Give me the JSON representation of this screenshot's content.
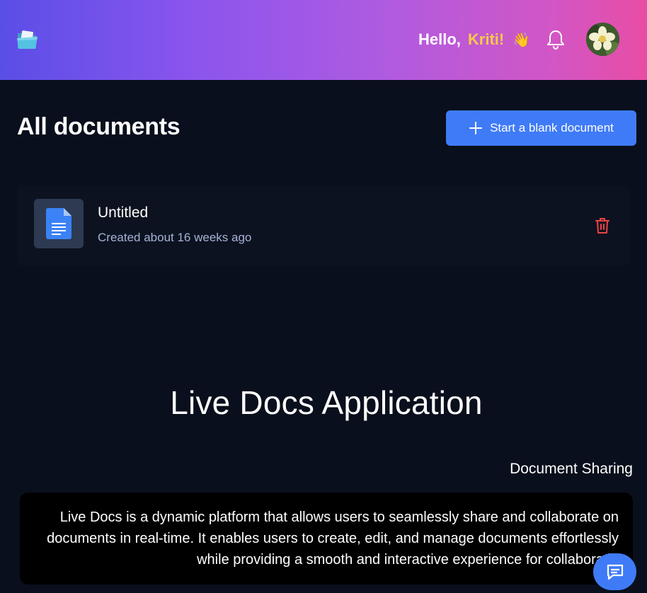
{
  "header": {
    "greeting_hello": "Hello,",
    "greeting_name": "Kriti!",
    "greeting_emoji": "👋",
    "icons": {
      "logo": "folder-logo-icon",
      "notifications": "bell-icon",
      "avatar": "flower-avatar"
    }
  },
  "main": {
    "title": "All documents",
    "start_button_label": "Start a blank document",
    "documents": [
      {
        "title": "Untitled",
        "meta": "Created about 16 weeks ago"
      }
    ]
  },
  "about": {
    "title": "Live Docs Application",
    "section_title": "Document Sharing",
    "description": "Live Docs is a dynamic platform that allows users to seamlessly share and collaborate on documents in real-time. It enables users to create, edit, and manage documents effortlessly while providing a smooth and interactive experience for collaboratio"
  },
  "colors": {
    "background": "#090f1c",
    "accent": "#3f7bf7",
    "name_highlight": "#f7c948",
    "delete": "#ef4444"
  }
}
